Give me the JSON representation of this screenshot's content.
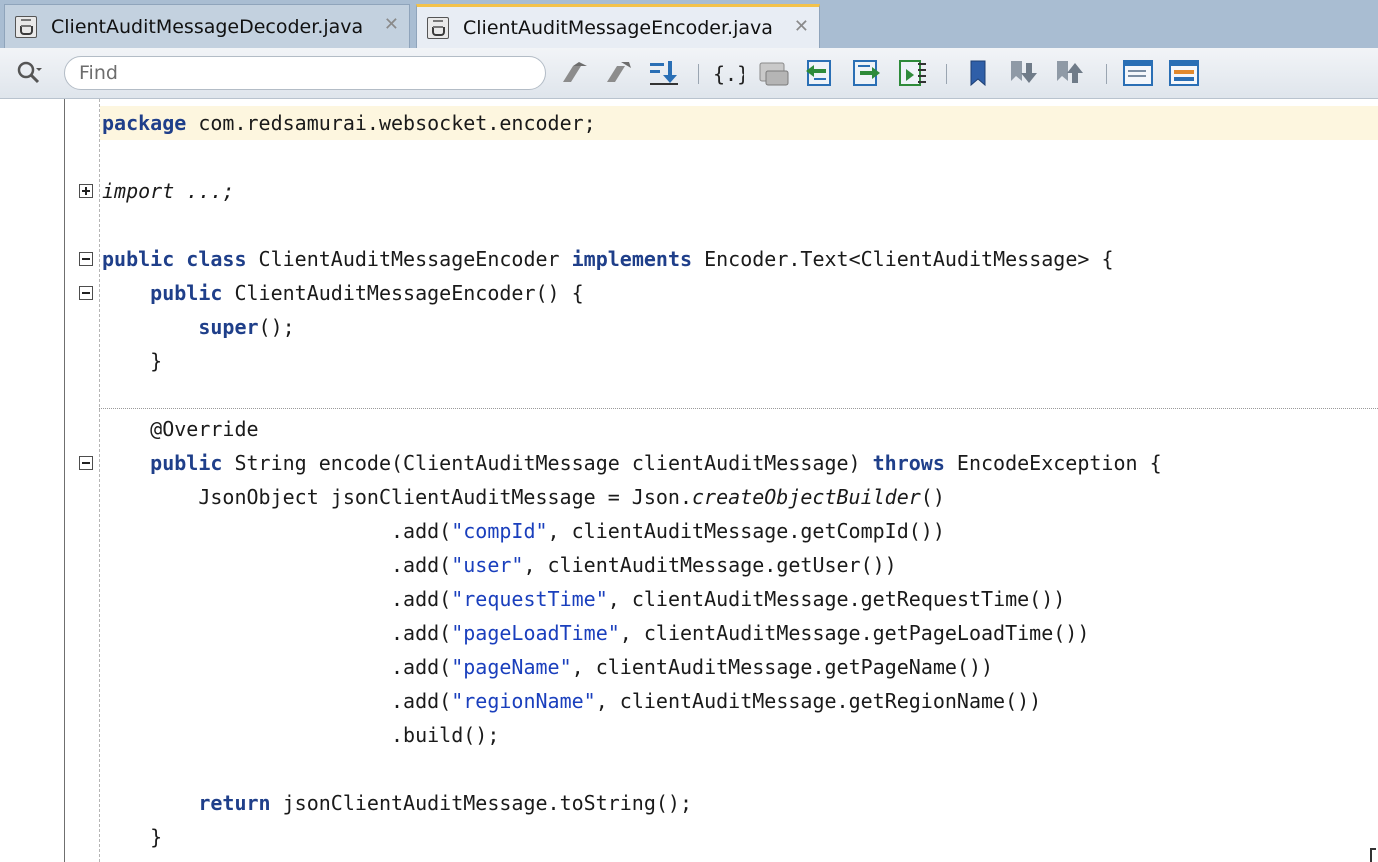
{
  "tabs": [
    {
      "label": "ClientAuditMessageDecoder.java",
      "close": "✕",
      "active": false
    },
    {
      "label": "ClientAuditMessageEncoder.java",
      "close": "✕",
      "active": true
    }
  ],
  "toolbar": {
    "find_placeholder": "Find",
    "buttons": [
      "find-previous-icon",
      "find-next-icon",
      "highlight-icon",
      "toggle-braces-icon",
      "toggle-comment-icon",
      "shift-left-icon",
      "shift-right-icon",
      "indent-icon",
      "bookmark-icon",
      "next-bookmark-icon",
      "previous-bookmark-icon",
      "split-vertical-icon",
      "split-horizontal-icon"
    ]
  },
  "editor": {
    "lines": [
      {
        "segments": [
          {
            "t": "package",
            "c": "kw"
          },
          {
            "t": " com.redsamurai.websocket.encoder;"
          }
        ]
      },
      {
        "segments": []
      },
      {
        "segments": [
          {
            "t": "import ...;",
            "c": "it"
          }
        ]
      },
      {
        "segments": []
      },
      {
        "segments": [
          {
            "t": "public",
            "c": "kw"
          },
          {
            "t": " "
          },
          {
            "t": "class",
            "c": "kw"
          },
          {
            "t": " ClientAuditMessageEncoder "
          },
          {
            "t": "implements",
            "c": "kw"
          },
          {
            "t": " Encoder.Text<ClientAuditMessage> {"
          }
        ]
      },
      {
        "segments": [
          {
            "t": "    "
          },
          {
            "t": "public",
            "c": "kw"
          },
          {
            "t": " ClientAuditMessageEncoder() {"
          }
        ]
      },
      {
        "segments": [
          {
            "t": "        "
          },
          {
            "t": "super",
            "c": "kw"
          },
          {
            "t": "();"
          }
        ]
      },
      {
        "segments": [
          {
            "t": "    }"
          }
        ]
      },
      {
        "segments": []
      },
      {
        "segments": [
          {
            "t": "    @Override"
          }
        ]
      },
      {
        "segments": [
          {
            "t": "    "
          },
          {
            "t": "public",
            "c": "kw"
          },
          {
            "t": " String encode(ClientAuditMessage clientAuditMessage) "
          },
          {
            "t": "throws",
            "c": "kw"
          },
          {
            "t": " EncodeException {"
          }
        ]
      },
      {
        "segments": [
          {
            "t": "        JsonObject jsonClientAuditMessage = Json."
          },
          {
            "t": "createObjectBuilder",
            "c": "it"
          },
          {
            "t": "()"
          }
        ]
      },
      {
        "segments": [
          {
            "t": "                        .add("
          },
          {
            "t": "\"compId\"",
            "c": "str"
          },
          {
            "t": ", clientAuditMessage.getCompId())"
          }
        ]
      },
      {
        "segments": [
          {
            "t": "                        .add("
          },
          {
            "t": "\"user\"",
            "c": "str"
          },
          {
            "t": ", clientAuditMessage.getUser())"
          }
        ]
      },
      {
        "segments": [
          {
            "t": "                        .add("
          },
          {
            "t": "\"requestTime\"",
            "c": "str"
          },
          {
            "t": ", clientAuditMessage.getRequestTime())"
          }
        ]
      },
      {
        "segments": [
          {
            "t": "                        .add("
          },
          {
            "t": "\"pageLoadTime\"",
            "c": "str"
          },
          {
            "t": ", clientAuditMessage.getPageLoadTime())"
          }
        ]
      },
      {
        "segments": [
          {
            "t": "                        .add("
          },
          {
            "t": "\"pageName\"",
            "c": "str"
          },
          {
            "t": ", clientAuditMessage.getPageName())"
          }
        ]
      },
      {
        "segments": [
          {
            "t": "                        .add("
          },
          {
            "t": "\"regionName\"",
            "c": "str"
          },
          {
            "t": ", clientAuditMessage.getRegionName())"
          }
        ]
      },
      {
        "segments": [
          {
            "t": "                        .build();"
          }
        ]
      },
      {
        "segments": []
      },
      {
        "segments": [
          {
            "t": "        "
          },
          {
            "t": "return",
            "c": "kw"
          },
          {
            "t": " jsonClientAuditMessage.toString();"
          }
        ]
      },
      {
        "segments": [
          {
            "t": "    }"
          }
        ]
      }
    ],
    "folds": [
      {
        "line": 2,
        "type": "plus"
      },
      {
        "line": 4,
        "type": "minus"
      },
      {
        "line": 5,
        "type": "minus"
      },
      {
        "line": 10,
        "type": "minus"
      }
    ]
  }
}
